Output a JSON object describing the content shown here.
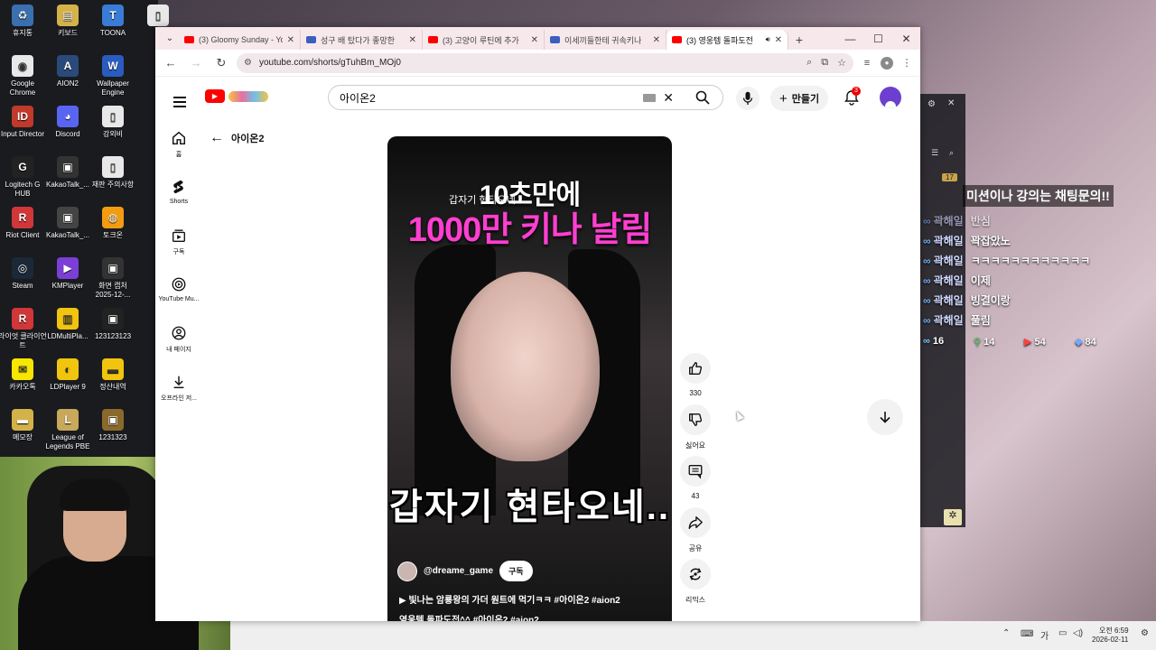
{
  "desktop": {
    "icons": [
      {
        "label": "휴지통",
        "color": "#3a6fb0",
        "glyph": "♻"
      },
      {
        "label": "키보드",
        "color": "#d4b24a",
        "glyph": "▤"
      },
      {
        "label": "TOONA",
        "color": "#3a7bd5",
        "glyph": "T"
      },
      {
        "label": "",
        "color": "#e8e8e8",
        "glyph": "▯"
      },
      {
        "label": "Google Chrome",
        "color": "#e8e8e8",
        "glyph": "◉"
      },
      {
        "label": "AION2",
        "color": "#2a4a7a",
        "glyph": "A"
      },
      {
        "label": "Wallpaper Engine",
        "color": "#2a5cc0",
        "glyph": "W"
      },
      {
        "label": "Input Director",
        "color": "#c0392b",
        "glyph": "ID"
      },
      {
        "label": "Discord",
        "color": "#5865f2",
        "glyph": "◕"
      },
      {
        "label": "강외비",
        "color": "#e8e8e8",
        "glyph": "▯"
      },
      {
        "label": "Logitech G HUB",
        "color": "#222",
        "glyph": "G"
      },
      {
        "label": "KakaoTalk_...",
        "color": "#333",
        "glyph": "▣"
      },
      {
        "label": "재판 주의사항",
        "color": "#e8e8e8",
        "glyph": "▯"
      },
      {
        "label": "Riot Client",
        "color": "#d13639",
        "glyph": "R"
      },
      {
        "label": "KakaoTalk_...",
        "color": "#444",
        "glyph": "▣"
      },
      {
        "label": "토크온",
        "color": "#f39c12",
        "glyph": "◍"
      },
      {
        "label": "Steam",
        "color": "#1b2838",
        "glyph": "◎"
      },
      {
        "label": "KMPlayer",
        "color": "#7b3fd6",
        "glyph": "▶"
      },
      {
        "label": "화면 캡처 2025-12-...",
        "color": "#333",
        "glyph": "▣"
      },
      {
        "label": "라이엇 클라이언트",
        "color": "#d13639",
        "glyph": "R"
      },
      {
        "label": "LDMultiPla...",
        "color": "#f1c40f",
        "glyph": "▥"
      },
      {
        "label": "123123123",
        "color": "#222",
        "glyph": "▣"
      },
      {
        "label": "카카오톡",
        "color": "#f7e600",
        "glyph": "✉"
      },
      {
        "label": "LDPlayer 9",
        "color": "#f1c40f",
        "glyph": "◐"
      },
      {
        "label": "정산내역",
        "color": "#f1c40f",
        "glyph": "▬"
      },
      {
        "label": "메모장",
        "color": "#d4b24a",
        "glyph": "▬"
      },
      {
        "label": "League of Legends PBE",
        "color": "#c8a85a",
        "glyph": "L"
      },
      {
        "label": "1231323",
        "color": "#8a6a2a",
        "glyph": "▣"
      }
    ]
  },
  "browser": {
    "tabs": [
      {
        "title": "(3) Gloomy Sunday - Yo",
        "fav": "yt"
      },
      {
        "title": "성구 배 탔다가 좋망한",
        "fav": "b"
      },
      {
        "title": "(3) 고양이 루틴에 추가",
        "fav": "yt"
      },
      {
        "title": "이세끼들한테 귀속키나",
        "fav": "b"
      },
      {
        "title": "(3) 영웅템 돌파도전",
        "fav": "yt",
        "active": true
      }
    ],
    "url": "youtube.com/shorts/gTuhBm_MOj0"
  },
  "youtube": {
    "search_value": "아이온2",
    "create_label": "만들기",
    "notif_count": "3",
    "back_label": "아이온2",
    "guide": [
      {
        "label": "홈",
        "icon": "home-icon"
      },
      {
        "label": "Shorts",
        "icon": "shorts-icon"
      },
      {
        "label": "구독",
        "icon": "subscriptions-icon"
      },
      {
        "label": "YouTube Mu...",
        "icon": "youtube-music-icon"
      },
      {
        "label": "내 페이지",
        "icon": "account-icon"
      },
      {
        "label": "오프라인 저...",
        "icon": "download-icon"
      }
    ],
    "video": {
      "title_line1": "10초만에",
      "title_line2": "1000만 키나 날림",
      "small_caption": "갑자기 현타오네.",
      "big_caption": "갑자기 현타오네..",
      "channel": "@dreame_game",
      "subscribe_label": "구독",
      "desc_line1": "▶ 빛나는 암룡왕의 가더 원트에 먹기ㅋㅋ #아이온2 #aion2",
      "desc_line2": "영웅템 돌파도전^^ #아이온2 #aion2"
    },
    "actions": [
      {
        "label": "330",
        "icon": "like-icon"
      },
      {
        "label": "싫어요",
        "icon": "dislike-icon"
      },
      {
        "label": "43",
        "icon": "comment-icon"
      },
      {
        "label": "공유",
        "icon": "share-icon"
      },
      {
        "label": "리믹스",
        "icon": "remix-icon"
      }
    ]
  },
  "stream_overlay": {
    "badge_count": "17",
    "notice": "미션이나 강의는 채팅문의!!",
    "chat": [
      {
        "name": "곽해일",
        "msg": "반심"
      },
      {
        "name": "곽해일",
        "msg": "꽉잡았노"
      },
      {
        "name": "곽해일",
        "msg": "ㅋㅋㅋㅋㅋㅋㅋㅋㅋㅋㅋㅋ"
      },
      {
        "name": "곽해일",
        "msg": "이제"
      },
      {
        "name": "곽해일",
        "msg": "빙결이랑"
      },
      {
        "name": "곽해일",
        "msg": "풀림"
      }
    ],
    "viewers": [
      "16",
      "14",
      "54",
      "84"
    ]
  },
  "taskbar": {
    "time": "오전 6:59",
    "date": "2026-02-11",
    "ime": "가"
  }
}
